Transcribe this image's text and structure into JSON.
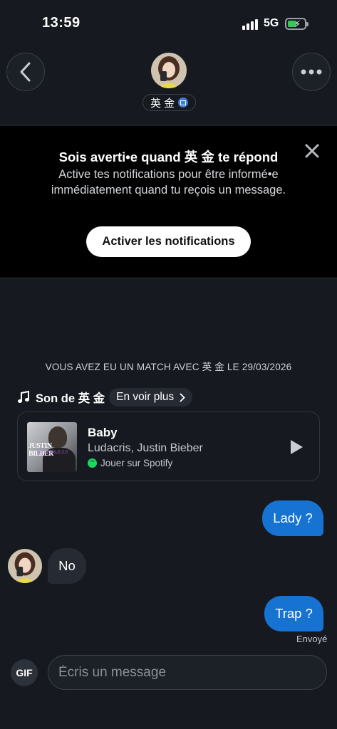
{
  "status_bar": {
    "time": "13:59",
    "network": "5G"
  },
  "header": {
    "contact_name": "英 金"
  },
  "notification_banner": {
    "title": "Sois averti•e quand 英 金 te répond",
    "body": "Active tes notifications pour être informé•e immédiatement quand tu reçois un message.",
    "button_label": "Activer les notifications"
  },
  "match_info": "VOUS AVEZ EU UN MATCH AVEC 英 金 LE 29/03/2026",
  "song_section": {
    "title": "Son de 英 金",
    "see_more_label": "En voir plus",
    "track": {
      "name": "Baby",
      "artists": "Ludacris, Justin Bieber",
      "album_text": "JUSTIN BIEBER",
      "album_subtext": "MY WORLD 2.0",
      "spotify_label": "Jouer sur Spotify"
    }
  },
  "messages": [
    {
      "direction": "out",
      "text": "Lady ?"
    },
    {
      "direction": "in",
      "text": "No"
    },
    {
      "direction": "out",
      "text": "Trap ?"
    }
  ],
  "sent_status": "Envoyé",
  "composer": {
    "gif_label": "GIF",
    "placeholder": "Écris un message"
  },
  "colors": {
    "outgoing_bubble": "#1673d2",
    "incoming_bubble": "#262b33",
    "spotify_green": "#1ed760",
    "background": "#161a20"
  }
}
